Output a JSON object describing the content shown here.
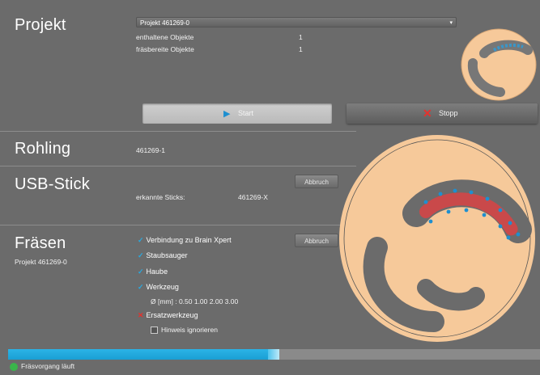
{
  "colors": {
    "background": "#6b6b6b",
    "accent_blue": "#29a9e0",
    "disc": "#f6c99a",
    "stop_red": "#e5322d",
    "ok_green": "#3ab54a"
  },
  "projekt": {
    "heading": "Projekt",
    "select_value": "Projekt 461269-0",
    "rows": [
      {
        "label": "enthaltene Objekte",
        "value": "1"
      },
      {
        "label": "fräsbereite Objekte",
        "value": "1"
      }
    ]
  },
  "buttons": {
    "start": "Start",
    "stop": "Stopp"
  },
  "rohling": {
    "heading": "Rohling",
    "value": "461269-1"
  },
  "usb": {
    "heading": "USB-Stick",
    "label": "erkannte Sticks:",
    "value": "461269-X",
    "abort": "Abbruch"
  },
  "fraesen": {
    "heading": "Fräsen",
    "subtitle": "Projekt 461269-0",
    "abort": "Abbruch",
    "checks": [
      {
        "label": "Verbindung zu Brain Xpert",
        "state": "ok"
      },
      {
        "label": "Staubsauger",
        "state": "ok"
      },
      {
        "label": "Haube",
        "state": "ok"
      },
      {
        "label": "Werkzeug",
        "state": "ok"
      }
    ],
    "tool_diameters": "Ø [mm] : 0.50   1.00   2.00   3.00",
    "replacement": {
      "label": "Ersatzwerkzeug",
      "state": "error"
    },
    "ignore_hint": "Hinweis ignorieren"
  },
  "progress": {
    "fraction": 0.51
  },
  "status": {
    "text": "Fräsvorgang läuft"
  }
}
